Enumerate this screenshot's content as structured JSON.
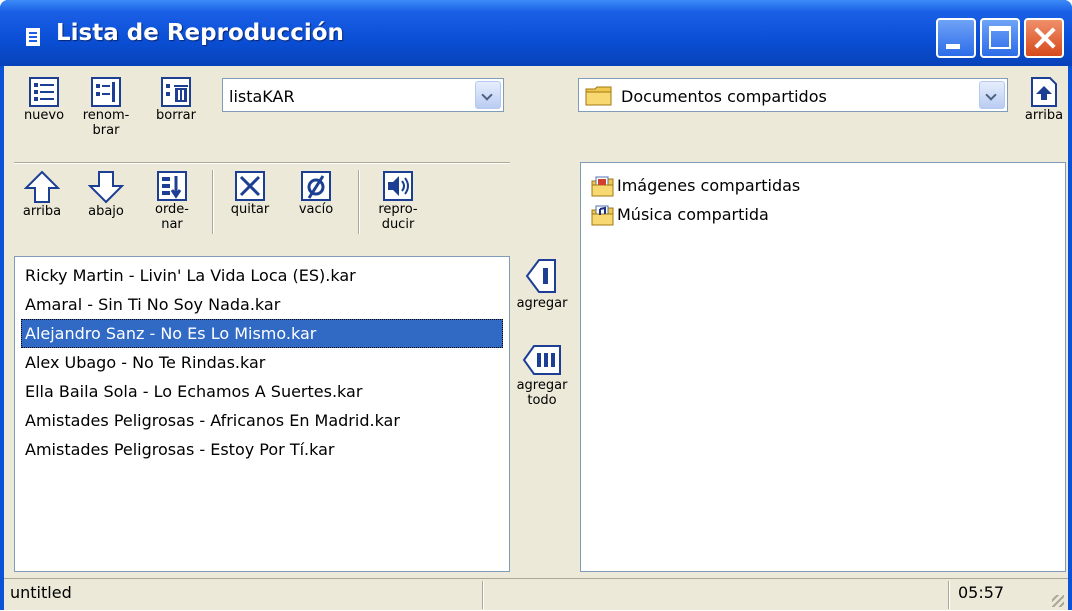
{
  "window": {
    "title": "Lista de Reproducción"
  },
  "playlist_toolbar": {
    "new_label": "nuevo",
    "rename_label": "renom-\nbrar",
    "delete_label": "borrar",
    "playlist_select": "listaKAR"
  },
  "folder_toolbar": {
    "folder_select": "Documentos compartidos",
    "up_label": "arriba"
  },
  "edit_toolbar": {
    "up_label": "arriba",
    "down_label": "abajo",
    "sort_label": "orde-\nnar",
    "remove_label": "quitar",
    "empty_label": "vacío",
    "play_label": "repro-\nducir"
  },
  "playlist": {
    "items": [
      "Ricky Martin - Livin' La Vida Loca (ES).kar",
      "Amaral - Sin Ti No Soy Nada.kar",
      "Alejandro Sanz - No Es Lo Mismo.kar",
      "Alex Ubago - No Te Rindas.kar",
      "Ella Baila Sola - Lo Echamos A Suertes.kar",
      "Amistades Peligrosas - Africanos En Madrid.kar",
      "Amistades Peligrosas - Estoy Por Tí.kar"
    ],
    "selected_index": 2
  },
  "transfer": {
    "add_label": "agregar",
    "add_all_label": "agregar\ntodo"
  },
  "files": {
    "items": [
      {
        "label": "Imágenes compartidas",
        "icon": "shared-pictures-folder-icon"
      },
      {
        "label": "Música compartida",
        "icon": "shared-music-folder-icon"
      }
    ]
  },
  "status": {
    "file": "untitled",
    "time": "05:57"
  }
}
